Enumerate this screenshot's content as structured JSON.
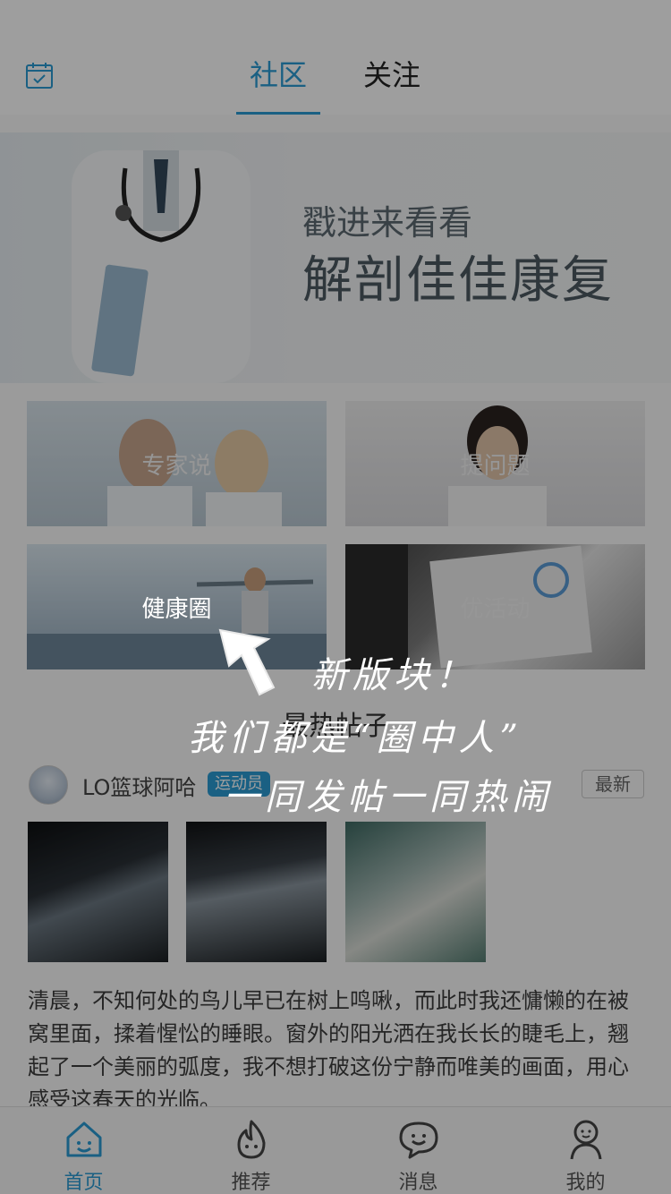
{
  "header": {
    "tabs": [
      {
        "label": "社区",
        "active": true
      },
      {
        "label": "关注",
        "active": false
      }
    ],
    "calendar_icon": "calendar-check-icon"
  },
  "banner": {
    "line1": "戳进来看看",
    "line2": "解剖佳佳康复"
  },
  "grid": [
    {
      "label": "专家说"
    },
    {
      "label": "提问题"
    },
    {
      "label": "健康圈"
    },
    {
      "label": "优活动"
    }
  ],
  "section": {
    "title": "最热帖子"
  },
  "post": {
    "username": "LO篮球阿哈",
    "badge": "运动员",
    "action": "最新",
    "text": "清晨，不知何处的鸟儿早已在树上鸣啾，而此时我还慵懒的在被窝里面，揉着惺忪的睡眼。窗外的阳光洒在我长长的睫毛上，翘起了一个美丽的弧度，我不想打破这份宁静而唯美的画面，用心感受这春天的光临。"
  },
  "guide": {
    "line1": "新版块！",
    "line2": "我们都是“圈中人”",
    "line3": "一同发帖一同热闹"
  },
  "tabbar": [
    {
      "label": "首页",
      "icon": "home-smile-icon",
      "active": true
    },
    {
      "label": "推荐",
      "icon": "flame-icon",
      "active": false
    },
    {
      "label": "消息",
      "icon": "chat-bubble-icon",
      "active": false
    },
    {
      "label": "我的",
      "icon": "person-icon",
      "active": false
    }
  ],
  "colors": {
    "accent": "#2a9bd4"
  }
}
